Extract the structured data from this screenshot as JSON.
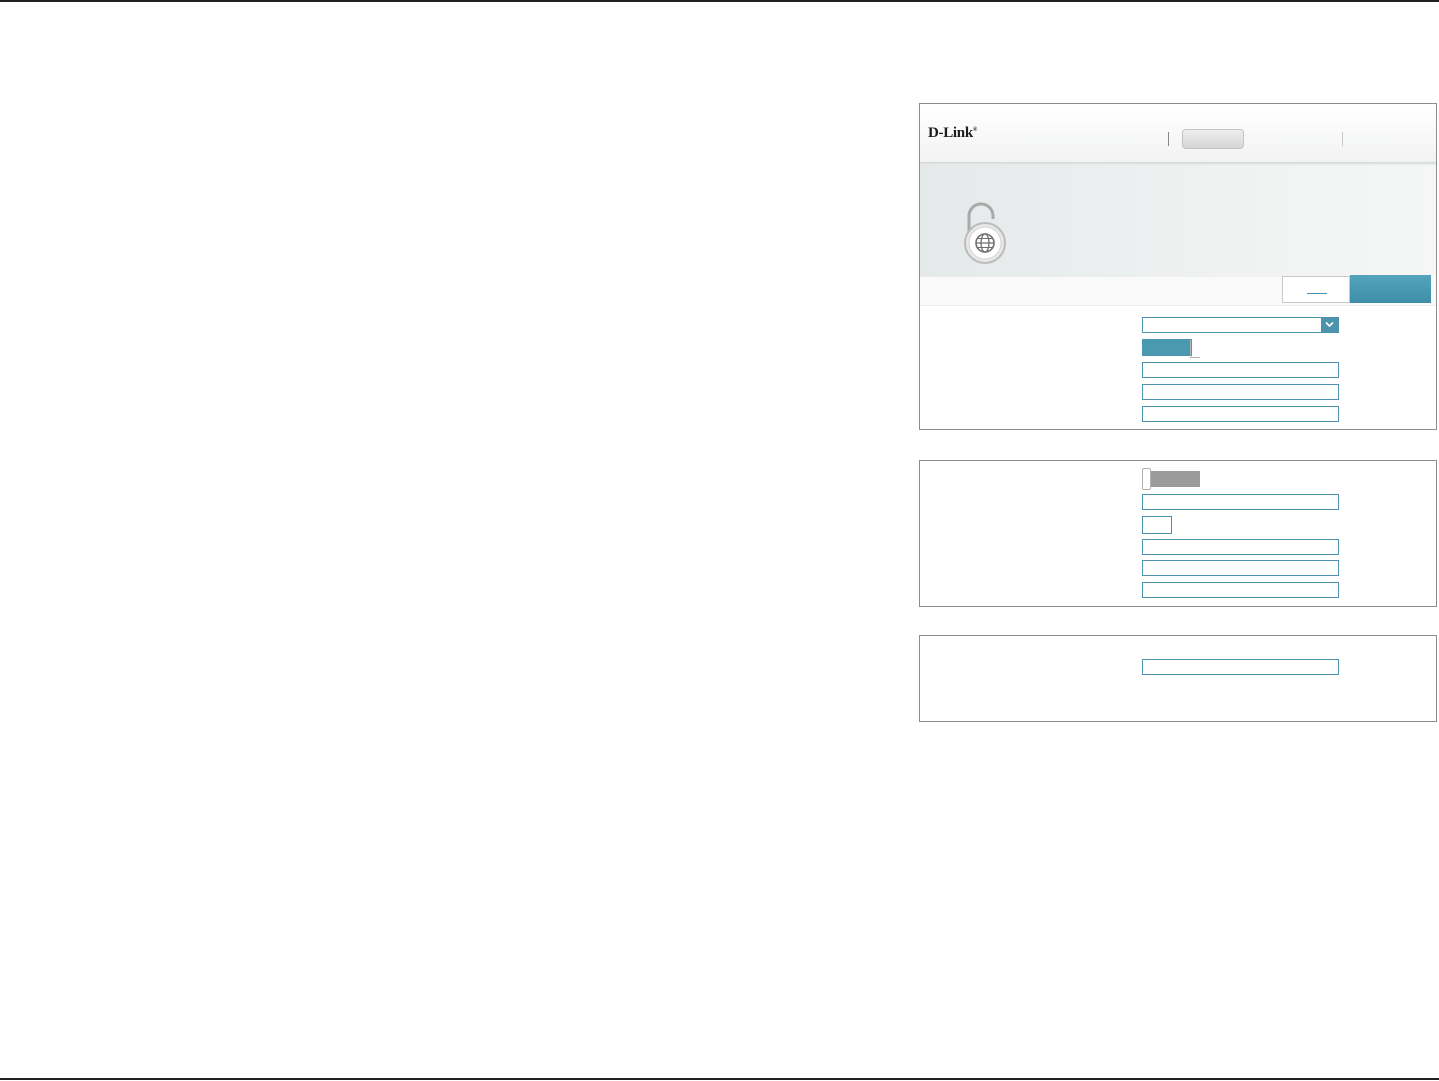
{
  "brand": {
    "logo_text": "D-Link",
    "logo_mark": "®"
  },
  "colors": {
    "accent": "#4e93ac",
    "save_button": "#4b98b1",
    "toggle_off": "#9b9b9b",
    "page_rule": "#231f20"
  },
  "icons": {
    "hero": "padlock-globe-icon",
    "dropdown": "chevron-down-icon"
  }
}
